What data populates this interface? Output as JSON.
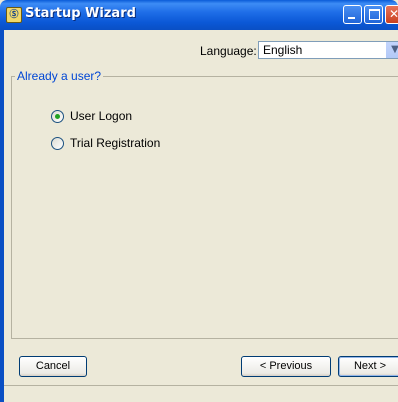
{
  "window": {
    "title": "Startup Wizard",
    "icon": "app-icon"
  },
  "language": {
    "label": "Language:",
    "value": "English"
  },
  "group": {
    "title": "Already a user?",
    "options": [
      {
        "label": "User Logon",
        "checked": true
      },
      {
        "label": "Trial Registration",
        "checked": false
      }
    ]
  },
  "buttons": {
    "cancel": "Cancel",
    "previous": "< Previous",
    "next": "Next >"
  }
}
